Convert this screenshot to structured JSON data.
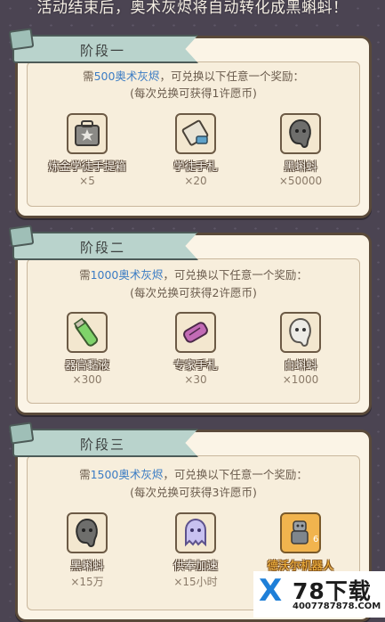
{
  "header": {
    "text": "活动结束后，奥术灰烬将自动转化成黑蝌蚪！"
  },
  "stages": [
    {
      "title": "阶段一",
      "req_prefix": "需",
      "req_num": "500",
      "req_mat": "奥术灰烬",
      "req_suffix": "，可兑换以下任意一个奖励：",
      "note": "(每次兑换可获得1许愿币)",
      "rewards": [
        {
          "name": "炼金学徒手提箱",
          "qty": "×5",
          "icon": "briefcase-icon"
        },
        {
          "name": "学徒手札",
          "qty": "×20",
          "icon": "scroll-icon"
        },
        {
          "name": "黑蝌蚪",
          "qty": "×50000",
          "icon": "black-tadpole-icon"
        }
      ]
    },
    {
      "title": "阶段二",
      "req_prefix": "需",
      "req_num": "1000",
      "req_mat": "奥术灰烬",
      "req_suffix": "，可兑换以下任意一个奖励：",
      "note": "(每次兑换可获得2许愿币)",
      "rewards": [
        {
          "name": "器官黏液",
          "qty": "×300",
          "icon": "vial-icon"
        },
        {
          "name": "专家手札",
          "qty": "×30",
          "icon": "purple-scroll-icon"
        },
        {
          "name": "白蝌蚪",
          "qty": "×1000",
          "icon": "white-tadpole-icon"
        }
      ]
    },
    {
      "title": "阶段三",
      "req_prefix": "需",
      "req_num": "1500",
      "req_mat": "奥术灰烬",
      "req_suffix": "，可兑换以下任意一个奖励：",
      "note": "(每次兑换可获得3许愿币)",
      "rewards": [
        {
          "name": "黑蝌蚪",
          "qty": "×15万",
          "icon": "black-tadpole-icon"
        },
        {
          "name": "供奉加速",
          "qty": "×15小时",
          "icon": "ghost-icon"
        },
        {
          "name": "德沃尔机器人",
          "qty": "",
          "icon": "robot-icon",
          "badge": "6"
        }
      ]
    }
  ],
  "watermark": {
    "mark": "X",
    "text": "78下载",
    "url": "4007787878.COM"
  }
}
